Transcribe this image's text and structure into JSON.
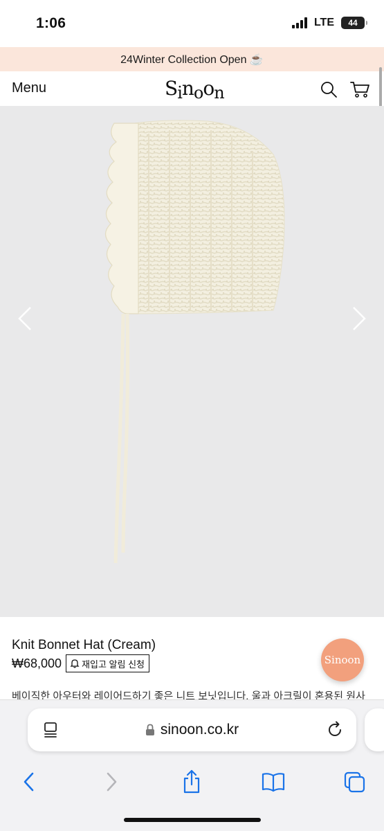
{
  "status_bar": {
    "time": "1:06",
    "network": "LTE",
    "battery": "44"
  },
  "announcement": {
    "text": "24Winter Collection Open ☕️"
  },
  "header": {
    "menu_label": "Menu",
    "logo_text": "Sinoon",
    "search_icon": "search-icon",
    "cart_icon": "cart-icon"
  },
  "product": {
    "image_description_icon": "knit-bonnet-image",
    "name": "Knit Bonnet Hat (Cream)",
    "price": "₩68,000",
    "restock_label": "재입고 알림 신청",
    "description_preview": "베이직한 아우터와 레이어드하기 좋은 니트 보닛입니다. 울과 아크릴이 혼용된 원사"
  },
  "chat_badge": {
    "text": "Sinoon"
  },
  "browser": {
    "url": "sinoon.co.kr",
    "toolbar": [
      "back-icon",
      "forward-icon",
      "share-icon",
      "bookmarks-icon",
      "tabs-icon"
    ]
  },
  "colors": {
    "announcement_bg": "#fbe6db",
    "badge": "#f2a07d",
    "ios_blue": "#1a73e8",
    "image_bg": "#e9e9ea"
  }
}
